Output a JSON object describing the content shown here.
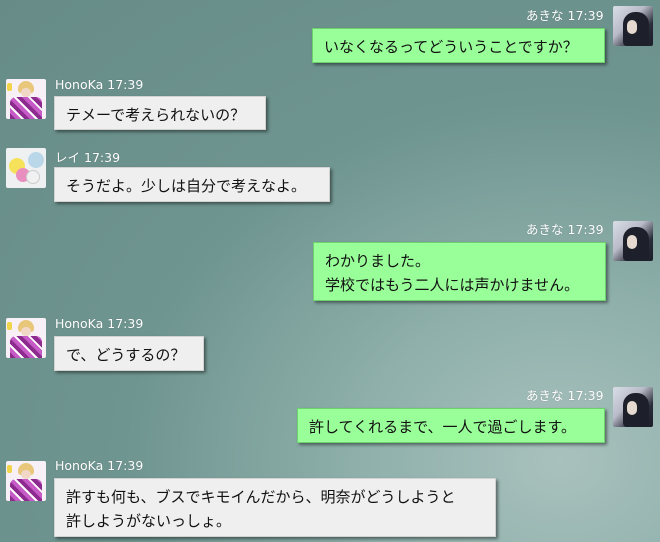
{
  "messages": [
    {
      "side": "right",
      "sender": "あきな",
      "time": "17:39",
      "lines": [
        "いなくなるってどういうことですか？"
      ]
    },
    {
      "side": "left",
      "sender": "HonoKa",
      "time": "17:39",
      "lines": [
        "テメーで考えられないの？"
      ]
    },
    {
      "side": "left",
      "sender": "レイ",
      "time": "17:39",
      "lines": [
        "そうだよ。少しは自分で考えなよ。"
      ]
    },
    {
      "side": "right",
      "sender": "あきな",
      "time": "17:39",
      "lines": [
        "わかりました。",
        "学校ではもう二人には声かけません。"
      ]
    },
    {
      "side": "left",
      "sender": "HonoKa",
      "time": "17:39",
      "lines": [
        "で、どうするの？"
      ]
    },
    {
      "side": "right",
      "sender": "あきな",
      "time": "17:39",
      "lines": [
        "許してくれるまで、一人で過ごします。"
      ]
    },
    {
      "side": "left",
      "sender": "HonoKa",
      "time": "17:39",
      "lines": [
        "許すも何も、ブスでキモイんだから、明奈がどうしようと",
        "許しようがないっしょ。"
      ]
    }
  ],
  "colors": {
    "own_bubble": "#99ff99",
    "other_bubble": "#efefef",
    "background": "#6f9590"
  },
  "avatars": {
    "あきな": "akina-avatar-icon",
    "HonoKa": "honoka-avatar-icon",
    "レイ": "rei-avatar-icon"
  }
}
